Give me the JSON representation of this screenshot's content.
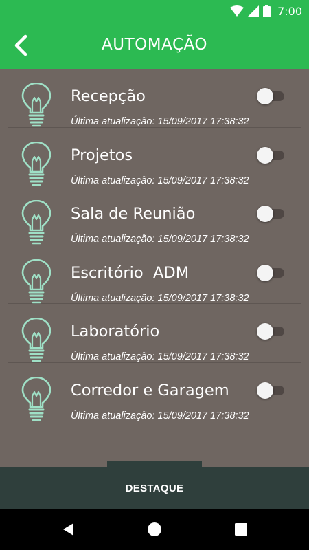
{
  "status_bar": {
    "time": "7:00",
    "icons": [
      "wifi-icon",
      "signal-icon",
      "battery-icon"
    ]
  },
  "app_bar": {
    "title": "AUTOMAÇÃO",
    "back_icon": "back-chevron-icon"
  },
  "colors": {
    "primary": "#2cba52",
    "list_background": "#6f6661",
    "bulb_outline": "#9fe0c6",
    "bottom_bar": "#2f3f3c"
  },
  "items": [
    {
      "name": "Recepção",
      "updated": "Última atualização: 15/09/2017 17:38:32",
      "on": false
    },
    {
      "name": "Projetos",
      "updated": "Última atualização: 15/09/2017 17:38:32",
      "on": false
    },
    {
      "name": "Sala de Reunião",
      "updated": "Última atualização: 15/09/2017 17:38:32",
      "on": false
    },
    {
      "name": "Escritório  ADM",
      "updated": "Última atualização: 15/09/2017 17:38:32",
      "on": false
    },
    {
      "name": "Laboratório",
      "updated": "Última atualização: 15/09/2017 17:38:32",
      "on": false
    },
    {
      "name": "Corredor e Garagem",
      "updated": "Última atualização: 15/09/2017 17:38:32",
      "on": false
    }
  ],
  "bottom_tab": {
    "label": "DESTAQUE"
  },
  "nav_bar": {
    "icons": [
      "back-triangle-icon",
      "home-circle-icon",
      "recents-square-icon"
    ]
  }
}
